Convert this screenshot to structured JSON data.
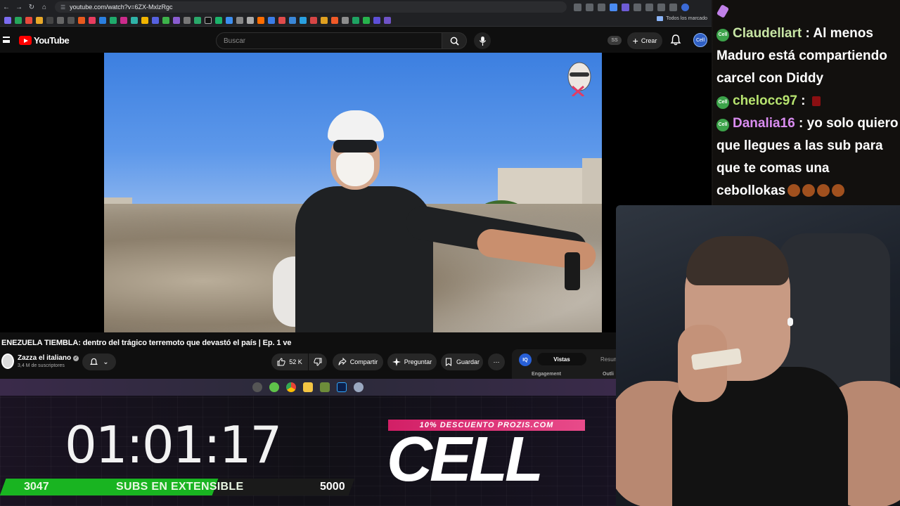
{
  "browser": {
    "url": "youtube.com/watch?v=6ZX-MxlzRgc",
    "bookmarks_folder_label": "Todos los marcado"
  },
  "youtube": {
    "logo_text": "YouTube",
    "search_placeholder": "Buscar",
    "ss_badge": "SS",
    "create_label": "Crear",
    "avatar_label": "Cell"
  },
  "video": {
    "title": "ENEZUELA TIEMBLA: dentro del trágico terremoto que devastó el país | Ep. 1 ve",
    "channel_name": "Zazza el italiano",
    "subscribers": "3,4 M de suscriptores",
    "likes": "52 K",
    "share_label": "Compartir",
    "ask_label": "Preguntar",
    "save_label": "Guardar"
  },
  "side_panel": {
    "badge": "IQ",
    "tab_active": "Vistas",
    "tab_other": "Resum",
    "section_1": "Engagement",
    "section_2": "Outli"
  },
  "overlay": {
    "timer": "01:01:17",
    "subs_current": "3047",
    "subs_label": "SUBS EN EXTENSIBLE",
    "subs_goal": "5000",
    "subs_progress": 0.6094,
    "promo": "10% DESCUENTO PROZIS.COM",
    "brand": "CELL"
  },
  "chat": {
    "badge_text": "Cell",
    "messages": [
      {
        "user": "Claudellart",
        "text": "Al menos Maduro está compartiendo carcel con Diddy"
      },
      {
        "user": "chelocc97",
        "text": ""
      },
      {
        "user": "Danalia16",
        "text": "yo solo quiero que llegues a las sub para que te comas una cebollokas"
      }
    ]
  },
  "colors": {
    "youtube_red": "#ff0000",
    "subs_green": "#19b421",
    "promo_pink": "#d21f66",
    "chat_user1": "#c8e6a5",
    "chat_user2": "#b7e36f",
    "chat_user3": "#d98cf0"
  },
  "icons": [
    "back-icon",
    "forward-icon",
    "reload-icon",
    "home-icon",
    "search-icon",
    "mic-icon",
    "bell-icon",
    "plus-icon",
    "like-icon",
    "dislike-icon",
    "share-icon",
    "sparkle-icon",
    "bookmark-icon",
    "more-icon",
    "folder-icon",
    "verified-icon"
  ]
}
